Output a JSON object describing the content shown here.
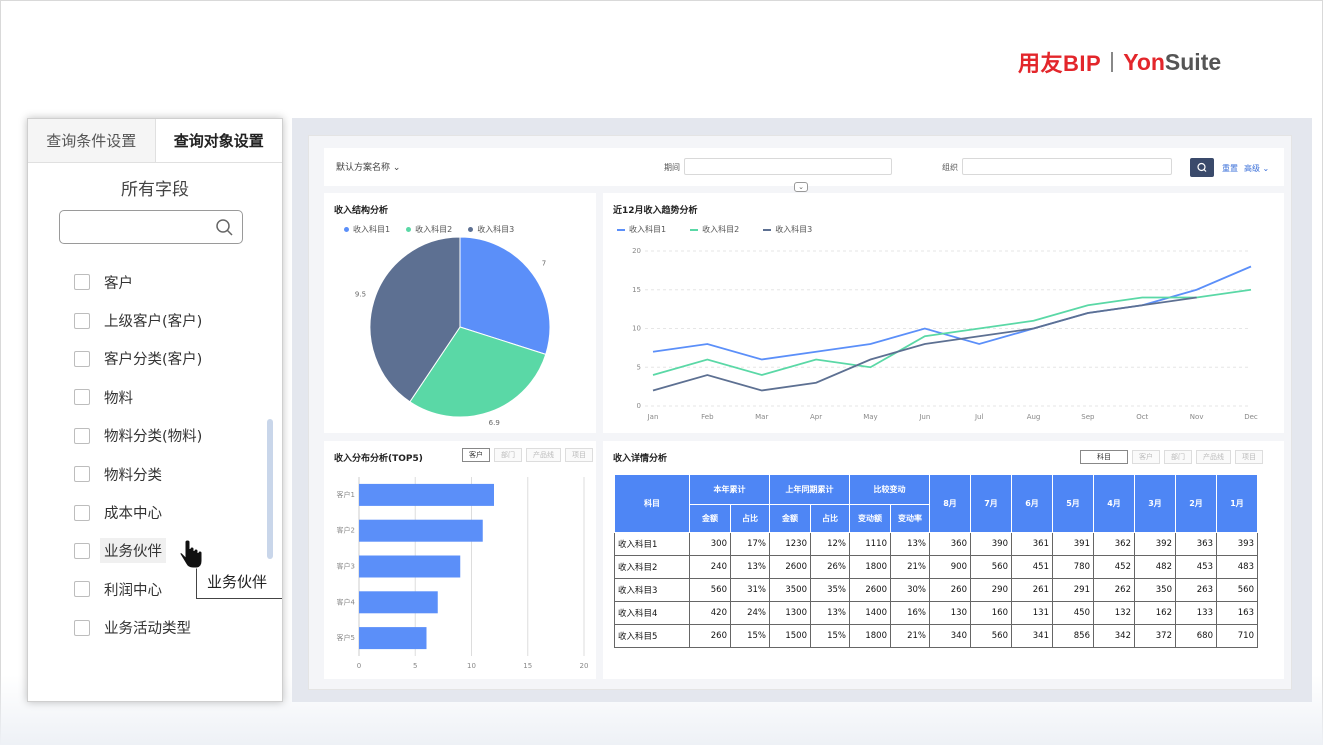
{
  "brand": {
    "cn": "用友BIP",
    "en_prefix": "Yon",
    "en_suffix": "Suite"
  },
  "left_panel": {
    "tabs": [
      {
        "label": "查询条件设置",
        "active": false
      },
      {
        "label": "查询对象设置",
        "active": true
      }
    ],
    "fields_title": "所有字段",
    "search_placeholder": "",
    "fields": [
      "客户",
      "上级客户(客户)",
      "客户分类(客户)",
      "物料",
      "物料分类(物料)",
      "物料分类",
      "成本中心",
      "业务伙伴",
      "利润中心",
      "业务活动类型"
    ],
    "hover_field": "业务伙伴",
    "tooltip": "业务伙伴"
  },
  "filter": {
    "scheme": "默认方案名称",
    "period_label": "期间",
    "org_label": "组织",
    "reset": "重置",
    "advanced": "高级"
  },
  "pie": {
    "title": "收入结构分析",
    "legend": [
      "收入科目1",
      "收入科目2",
      "收入科目3"
    ],
    "labels": [
      "7",
      "6.9",
      "9.5"
    ],
    "colors": [
      "#5b8ff9",
      "#5ad8a6",
      "#5d7092"
    ]
  },
  "line": {
    "title": "近12月收入趋势分析",
    "legend": [
      "收入科目1",
      "收入科目2",
      "收入科目3"
    ],
    "colors": [
      "#5b8ff9",
      "#5ad8a6",
      "#5d7092"
    ]
  },
  "bar": {
    "title": "收入分布分析(TOP5)",
    "tabs": [
      "客户",
      "部门",
      "产品线",
      "项目"
    ]
  },
  "detail": {
    "title": "收入详情分析",
    "tabs": [
      "科目",
      "客户",
      "部门",
      "产品线",
      "项目"
    ],
    "header_top": [
      "科目",
      "本年累计",
      "上年同期累计",
      "比较变动",
      "8月",
      "7月",
      "6月",
      "5月",
      "4月",
      "3月",
      "2月",
      "1月"
    ],
    "header_sub": [
      "金额",
      "占比",
      "金额",
      "占比",
      "变动额",
      "变动率"
    ],
    "rows": [
      [
        "收入科目1",
        "300",
        "17%",
        "1230",
        "12%",
        "1110",
        "13%",
        "360",
        "390",
        "361",
        "391",
        "362",
        "392",
        "363",
        "393"
      ],
      [
        "收入科目2",
        "240",
        "13%",
        "2600",
        "26%",
        "1800",
        "21%",
        "900",
        "560",
        "451",
        "780",
        "452",
        "482",
        "453",
        "483"
      ],
      [
        "收入科目3",
        "560",
        "31%",
        "3500",
        "35%",
        "2600",
        "30%",
        "260",
        "290",
        "261",
        "291",
        "262",
        "350",
        "263",
        "560"
      ],
      [
        "收入科目4",
        "420",
        "24%",
        "1300",
        "13%",
        "1400",
        "16%",
        "130",
        "160",
        "131",
        "450",
        "132",
        "162",
        "133",
        "163"
      ],
      [
        "收入科目5",
        "260",
        "15%",
        "1500",
        "15%",
        "1800",
        "21%",
        "340",
        "560",
        "341",
        "856",
        "342",
        "372",
        "680",
        "710"
      ]
    ]
  },
  "chart_data": [
    {
      "type": "pie",
      "title": "收入结构分析",
      "categories": [
        "收入科目1",
        "收入科目2",
        "收入科目3"
      ],
      "values": [
        7,
        6.9,
        9.5
      ]
    },
    {
      "type": "line",
      "title": "近12月收入趋势分析",
      "x": [
        "Jan",
        "Feb",
        "Mar",
        "Apr",
        "May",
        "Jun",
        "Jul",
        "Aug",
        "Sep",
        "Oct",
        "Nov",
        "Dec"
      ],
      "ylim": [
        0,
        20
      ],
      "yticks": [
        0,
        5,
        10,
        15,
        20
      ],
      "series": [
        {
          "name": "收入科目1",
          "values": [
            7,
            8,
            6,
            7,
            8,
            10,
            8,
            10,
            12,
            13,
            15,
            18
          ]
        },
        {
          "name": "收入科目2",
          "values": [
            4,
            6,
            4,
            6,
            5,
            9,
            10,
            11,
            13,
            14,
            14,
            15
          ]
        },
        {
          "name": "收入科目3",
          "values": [
            2,
            4,
            2,
            3,
            6,
            8,
            9,
            10,
            12,
            13,
            14,
            null
          ]
        }
      ]
    },
    {
      "type": "bar",
      "title": "收入分布分析(TOP5)",
      "categories": [
        "客户1",
        "客户2",
        "客户3",
        "客户4",
        "客户5"
      ],
      "values": [
        12,
        11,
        9,
        7,
        6
      ],
      "xlim": [
        0,
        20
      ],
      "xticks": [
        0,
        5,
        10,
        15,
        20
      ]
    }
  ]
}
